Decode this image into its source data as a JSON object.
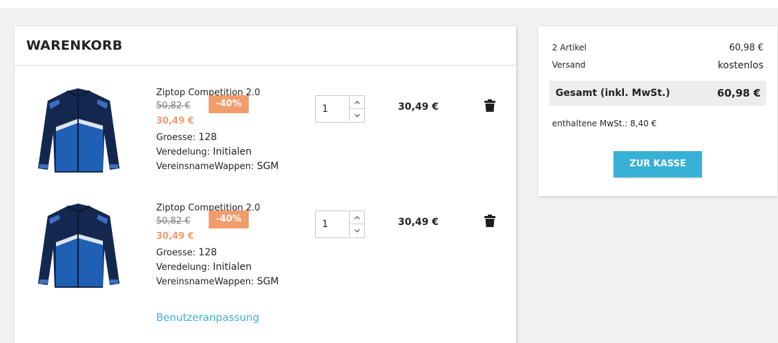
{
  "cart": {
    "title": "WARENKORB",
    "items": [
      {
        "name": "Ziptop Competition 2.0",
        "old_price": "50,82 €",
        "discount": "-40%",
        "new_price": "30,49 €",
        "size_label": "Groesse:",
        "size_value": "128",
        "finish_label": "Veredelung:",
        "finish_value": "Initialen",
        "crest_label": "VereinsnameWappen:",
        "crest_value": "SGM",
        "quantity": "1",
        "line_total": "30,49 €"
      },
      {
        "name": "Ziptop Competition 2.0",
        "old_price": "50,82 €",
        "discount": "-40%",
        "new_price": "30,49 €",
        "size_label": "Groesse:",
        "size_value": "128",
        "finish_label": "Veredelung:",
        "finish_value": "Initialen",
        "crest_label": "VereinsnameWappen:",
        "crest_value": "SGM",
        "quantity": "1",
        "line_total": "30,49 €"
      }
    ],
    "customize_link": "Benutzeranpassung"
  },
  "summary": {
    "articles_label": "2 Artikel",
    "articles_value": "60,98 €",
    "shipping_label": "Versand",
    "shipping_value": "kostenlos",
    "total_label": "Gesamt (inkl. MwSt.)",
    "total_value": "60,98 €",
    "vat_text": "enthaltene MwSt.: 8,40 €",
    "checkout_label": "ZUR KASSE"
  },
  "colors": {
    "accent": "#36b1d4",
    "discount": "#f39c6b",
    "jacket_dark": "#14284f",
    "jacket_blue": "#1f5fb4"
  }
}
